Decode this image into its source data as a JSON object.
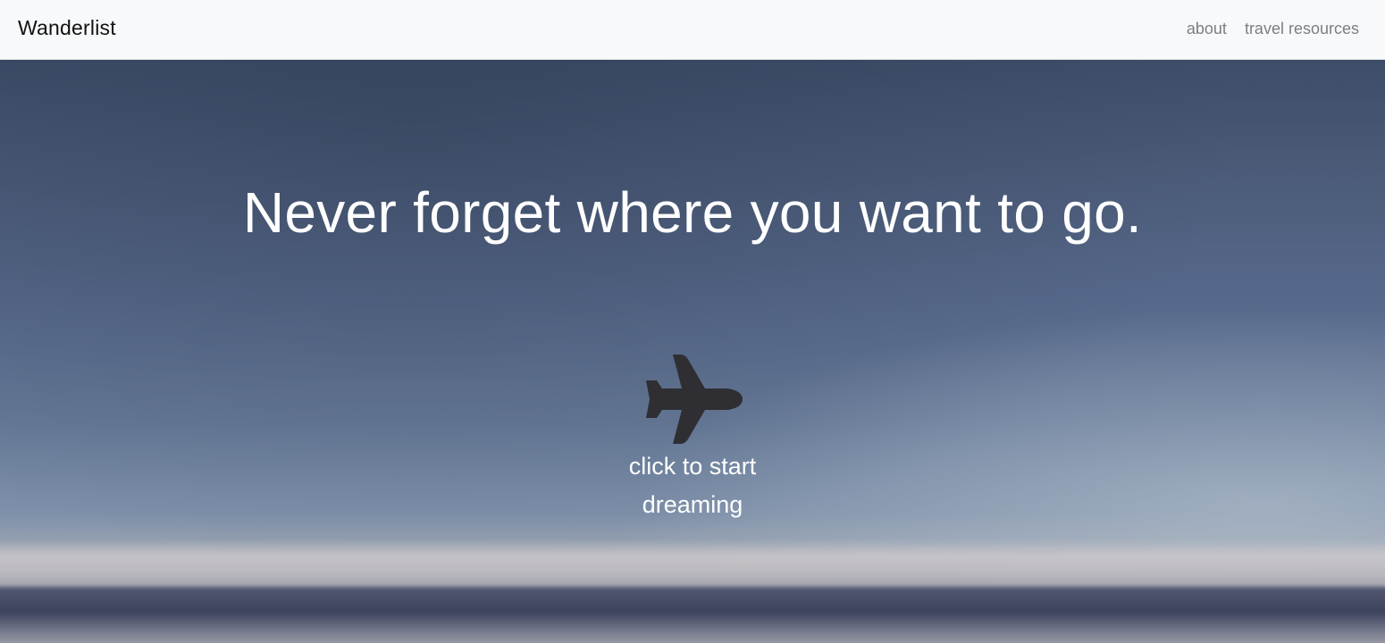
{
  "navbar": {
    "brand": "Wanderlist",
    "links": [
      "about",
      "travel resources"
    ]
  },
  "hero": {
    "headline": "Never forget where you want to go.",
    "cta_icon": "airplane-icon",
    "cta_label": "click to start dreaming"
  },
  "colors": {
    "navbar_bg": "#f8f9fa",
    "nav_link": "#7a7f85",
    "plane": "#2f2f33",
    "hero_text": "#ffffff"
  }
}
